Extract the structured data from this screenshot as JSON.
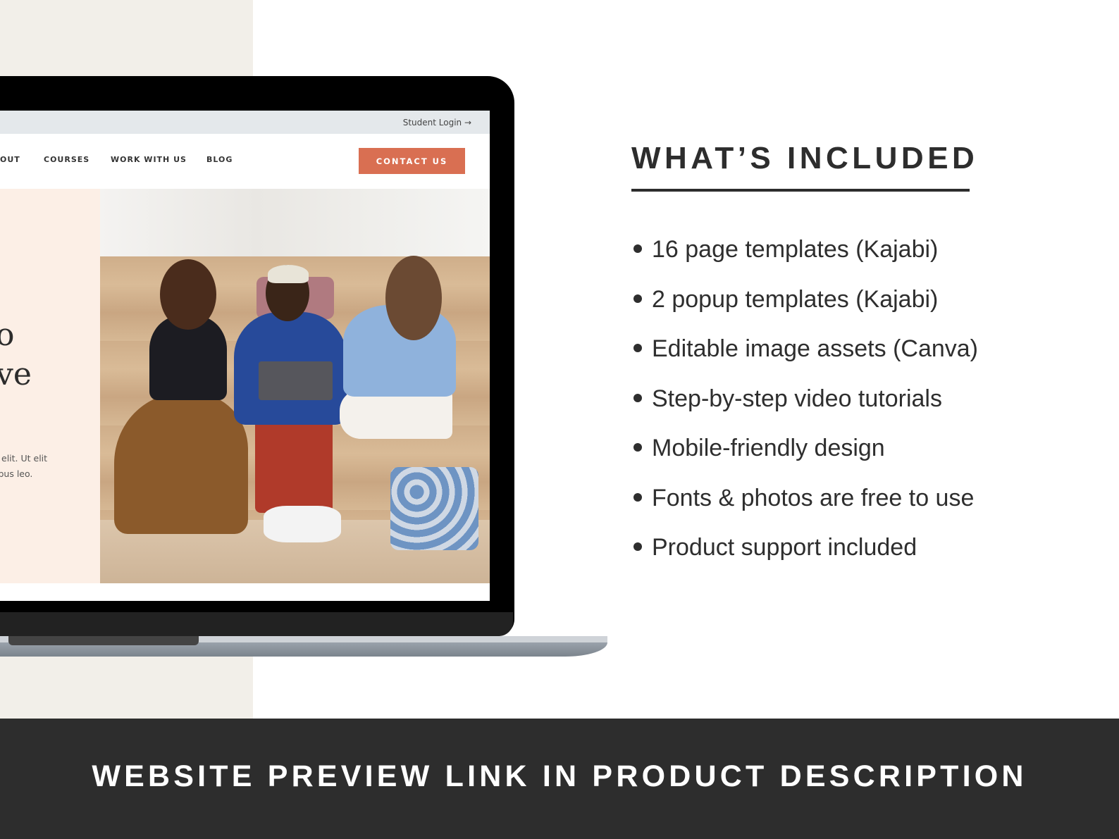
{
  "mockup_site": {
    "topbar": {
      "student_login": "Student Login →"
    },
    "nav": {
      "items": [
        {
          "label": "OUT"
        },
        {
          "label": "COURSES"
        },
        {
          "label": "WORK WITH US"
        },
        {
          "label": "BLOG"
        }
      ],
      "cta_label": "CONTACT US",
      "cta_color": "#d96f52"
    },
    "hero": {
      "heading_lines": [
        "o",
        "ve"
      ],
      "paragraph_lines": [
        "elit. Ut elit",
        "ibus leo."
      ],
      "photo_alt": "three women sitting on wooden steps looking at a laptop"
    }
  },
  "included": {
    "title": "WHAT’S INCLUDED",
    "items": [
      "16 page templates (Kajabi)",
      "2 popup templates (Kajabi)",
      "Editable image assets (Canva)",
      "Step-by-step video tutorials",
      "Mobile-friendly design",
      "Fonts & photos are free to use",
      "Product support included"
    ]
  },
  "banner": {
    "text": "WEBSITE PREVIEW LINK IN PRODUCT DESCRIPTION"
  },
  "colors": {
    "accent": "#d96f52",
    "dark": "#2d2d2d",
    "hero_bg": "#fcefe6",
    "side_bg": "#f2efe9"
  }
}
